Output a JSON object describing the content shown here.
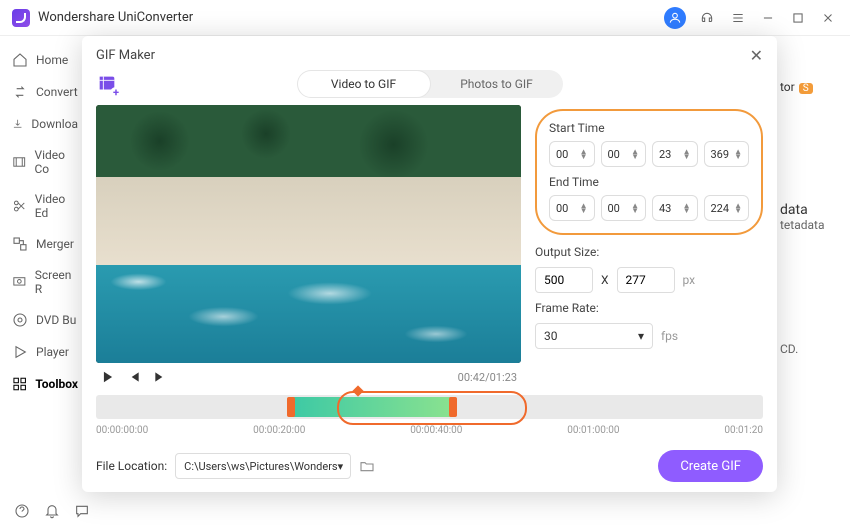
{
  "app": {
    "title": "Wondershare UniConverter"
  },
  "sidebar": {
    "items": [
      {
        "label": "Home"
      },
      {
        "label": "Convert"
      },
      {
        "label": "Downloa"
      },
      {
        "label": "Video Co"
      },
      {
        "label": "Video Ed"
      },
      {
        "label": "Merger"
      },
      {
        "label": "Screen R"
      },
      {
        "label": "DVD Bu"
      },
      {
        "label": "Player"
      },
      {
        "label": "Toolbox"
      }
    ]
  },
  "modal": {
    "title": "GIF Maker",
    "tabs": {
      "video": "Video to GIF",
      "photos": "Photos to GIF"
    },
    "start_label": "Start Time",
    "end_label": "End Time",
    "start": {
      "hh": "00",
      "mm": "00",
      "ss": "23",
      "ms": "369"
    },
    "end": {
      "hh": "00",
      "mm": "00",
      "ss": "43",
      "ms": "224"
    },
    "output_label": "Output Size:",
    "out_w": "500",
    "out_x": "X",
    "out_h": "277",
    "out_unit": "px",
    "rate_label": "Frame Rate:",
    "rate_value": "30",
    "rate_unit": "fps",
    "player_time": "00:42/01:23",
    "ticks": [
      "00:00:00:00",
      "00:00:20:00",
      "00:00:40:00",
      "00:01:00:00",
      "00:01:20"
    ],
    "file_label": "File Location:",
    "file_path": "C:\\Users\\ws\\Pictures\\Wonders",
    "create": "Create GIF"
  },
  "bg": {
    "tor": "tor",
    "s": "S",
    "data": "data",
    "meta": "tetadata",
    "cd": "CD."
  }
}
